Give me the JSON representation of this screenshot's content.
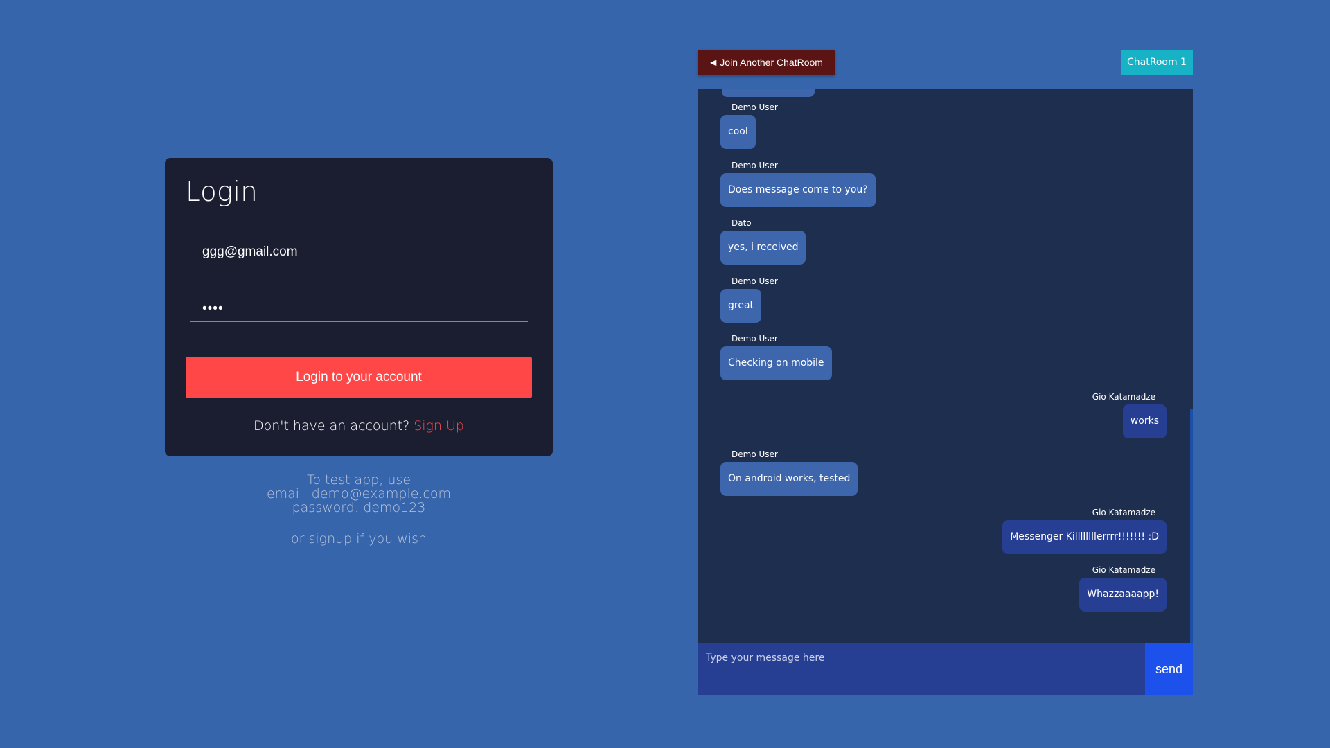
{
  "login": {
    "title": "Login",
    "email_value": "ggg@gmail.com",
    "password_value": "••••",
    "submit_label": "Login to your account",
    "signup_prompt": "Don't have an account?",
    "signup_link": "Sign Up"
  },
  "hint": {
    "line1": "To test app, use",
    "line2": "email: demo@example.com",
    "line3": "password: demo123",
    "line4": "or signup if you wish"
  },
  "chat": {
    "back_label": "Join Another ChatRoom",
    "back_icon": "triangle-left-icon",
    "room_name": "ChatRoom 1",
    "messages": [
      {
        "sender": "Demo User",
        "text": "cool",
        "side": "left"
      },
      {
        "sender": "Demo User",
        "text": "Does message come to you?",
        "side": "left"
      },
      {
        "sender": "Dato",
        "text": "yes, i received",
        "side": "left"
      },
      {
        "sender": "Demo User",
        "text": "great",
        "side": "left"
      },
      {
        "sender": "Demo User",
        "text": "Checking on mobile",
        "side": "left"
      },
      {
        "sender": "Gio Katamadze",
        "text": "works",
        "side": "right"
      },
      {
        "sender": "Demo User",
        "text": "On android works, tested",
        "side": "left"
      },
      {
        "sender": "Gio Katamadze",
        "text": "Messenger Killllllllerrrr!!!!!!! :D",
        "side": "right"
      },
      {
        "sender": "Gio Katamadze",
        "text": "Whazzaaaapp!",
        "side": "right"
      }
    ],
    "composer_placeholder": "Type your message here",
    "send_label": "send"
  },
  "colors": {
    "page_background": "#3665ab",
    "login_card": "#1b1e31",
    "login_button": "#ff4747",
    "back_button": "#5a1414",
    "room_badge": "#17b2c6",
    "chat_background": "#1e2e4f",
    "incoming_bubble": "#3d66ad",
    "outgoing_bubble": "#273f92",
    "send_button": "#1d51ec"
  }
}
